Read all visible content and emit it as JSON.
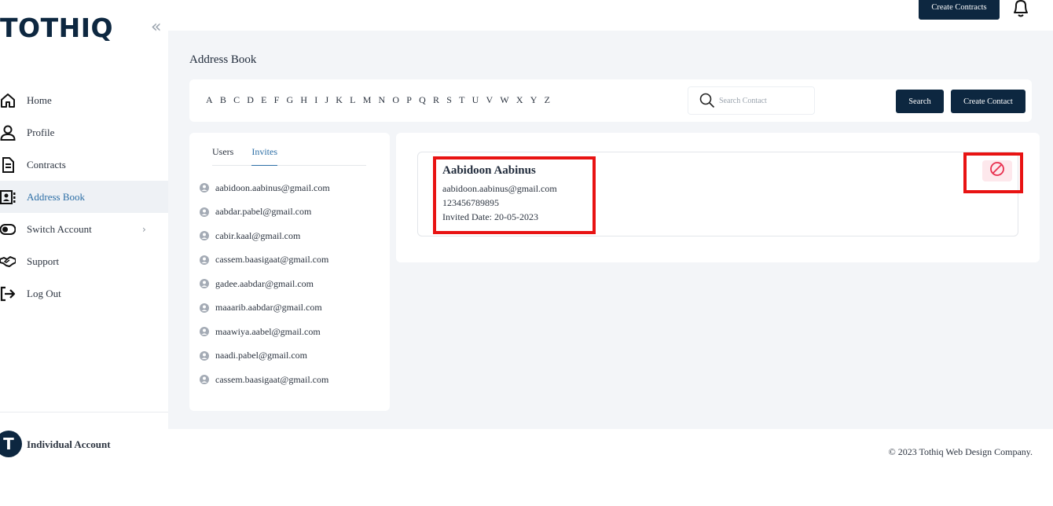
{
  "brand": {
    "logo_text": "TOTHIQ",
    "collapse_glyph": "«"
  },
  "sidebar": {
    "items": [
      {
        "label": "Home",
        "icon": "home-icon"
      },
      {
        "label": "Profile",
        "icon": "user-icon"
      },
      {
        "label": "Contracts",
        "icon": "document-icon"
      },
      {
        "label": "Address Book",
        "icon": "contact-card-icon",
        "active": true
      },
      {
        "label": "Switch Account",
        "icon": "toggle-icon",
        "chevron": "›"
      },
      {
        "label": "Support",
        "icon": "handshake-icon"
      },
      {
        "label": "Log Out",
        "icon": "logout-icon"
      }
    ],
    "account": {
      "avatar_letter": "T",
      "label": "Individual Account"
    }
  },
  "topbar": {
    "create_contracts_label": "Create Contracts",
    "bell_icon": "bell-icon"
  },
  "page": {
    "title": "Address Book"
  },
  "alphabet": [
    "A",
    "B",
    "C",
    "D",
    "E",
    "F",
    "G",
    "H",
    "I",
    "J",
    "K",
    "L",
    "M",
    "N",
    "O",
    "P",
    "Q",
    "R",
    "S",
    "T",
    "U",
    "V",
    "W",
    "X",
    "Y",
    "Z"
  ],
  "search": {
    "placeholder": "Search Contact",
    "value": "",
    "search_label": "Search",
    "create_contact_label": "Create Contact"
  },
  "tabs": [
    {
      "label": "Users",
      "active": false
    },
    {
      "label": "Invites",
      "active": true
    }
  ],
  "emails": [
    "aabidoon.aabinus@gmail.com",
    "aabdar.pabel@gmail.com",
    "cabir.kaal@gmail.com",
    "cassem.baasigaat@gmail.com",
    "gadee.aabdar@gmail.com",
    "maaarib.aabdar@gmail.com",
    "maawiya.aabel@gmail.com",
    "naadi.pabel@gmail.com",
    "cassem.baasigaat@gmail.com"
  ],
  "contact": {
    "name": "Aabidoon Aabinus",
    "email": "aabidoon.aabinus@gmail.com",
    "phone": "123456789895",
    "invited": "Invited Date: 20-05-2023"
  },
  "colors": {
    "navy": "#0d2740",
    "accent_blue": "#2d6fa6",
    "highlight_red": "#e81313",
    "block_red": "#e8304f"
  },
  "footer": {
    "copyright": "© 2023 Tothiq Web Design Company."
  }
}
